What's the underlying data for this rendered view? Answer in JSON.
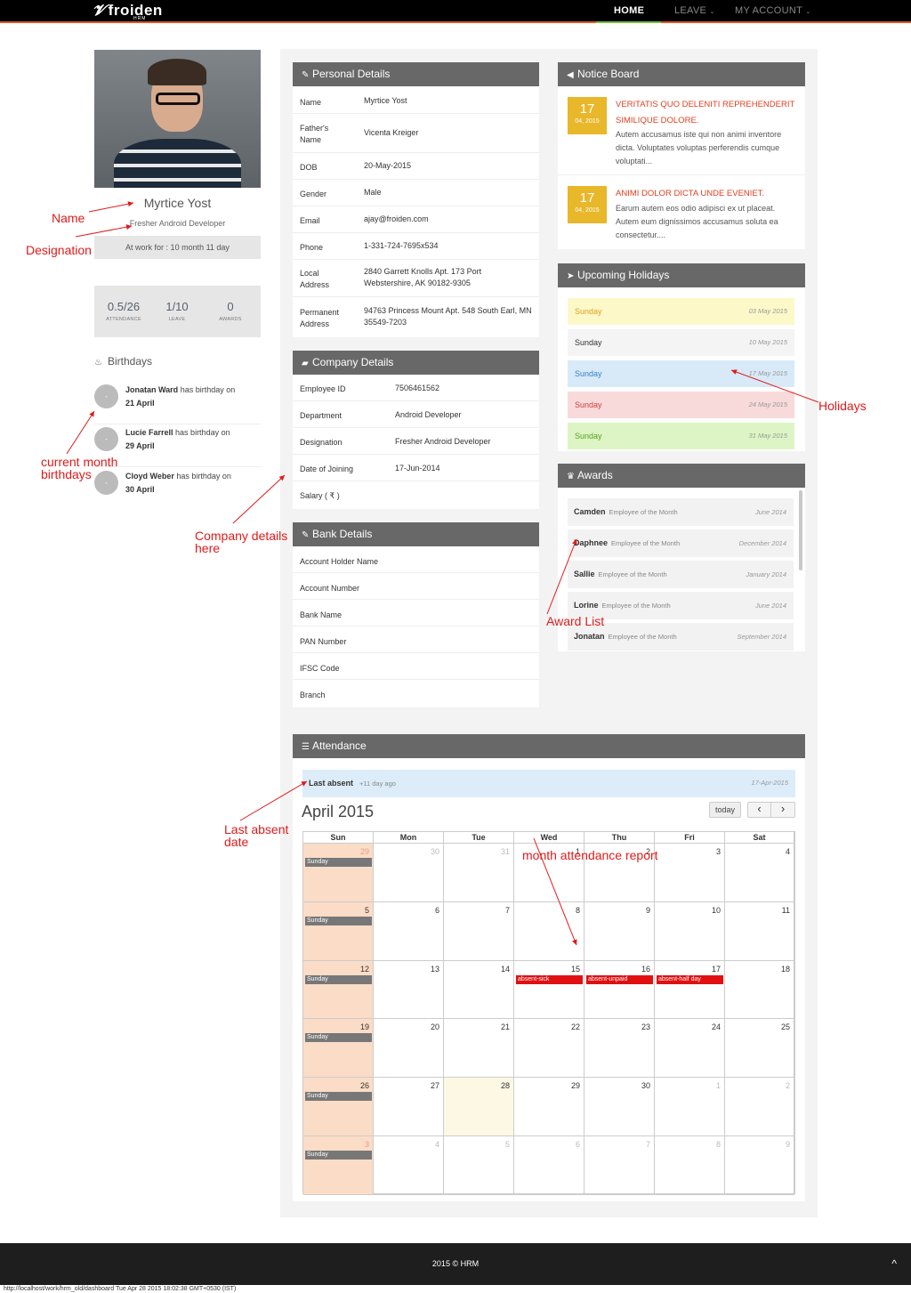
{
  "nav": {
    "logo": "froiden",
    "logo_sub": "HRM",
    "items": [
      "HOME",
      "LEAVE",
      "MY ACCOUNT"
    ]
  },
  "profile": {
    "name": "Myrtice Yost",
    "designation": "Fresher Android Developer",
    "work_for": "At work for : 10 month 11 day",
    "stats": [
      {
        "value": "0.5/26",
        "label": "ATTENDANCE"
      },
      {
        "value": "1/10",
        "label": "LEAVE"
      },
      {
        "value": "0",
        "label": "AWARDS"
      }
    ]
  },
  "birthdays": {
    "title": "Birthdays",
    "text": "has birthday on",
    "items": [
      {
        "name": "Jonatan Ward",
        "date": "21 April"
      },
      {
        "name": "Lucie Farrell",
        "date": "29 April"
      },
      {
        "name": "Cloyd Weber",
        "date": "30 April"
      }
    ]
  },
  "personal": {
    "title": "Personal Details",
    "rows": [
      {
        "k": "Name",
        "v": "Myrtice Yost"
      },
      {
        "k": "Father's Name",
        "v": "Vicenta Kreiger"
      },
      {
        "k": "DOB",
        "v": "20-May-2015"
      },
      {
        "k": "Gender",
        "v": "Male"
      },
      {
        "k": "Email",
        "v": "ajay@froiden.com"
      },
      {
        "k": "Phone",
        "v": "1-331-724-7695x534"
      },
      {
        "k": "Local Address",
        "v": "2840 Garrett Knolls Apt. 173 Port Webstershire, AK 90182-9305"
      },
      {
        "k": "Permanent Address",
        "v": "94763 Princess Mount Apt. 548 South Earl, MN 35549-7203"
      }
    ]
  },
  "company": {
    "title": "Company Details",
    "rows": [
      {
        "k": "Employee ID",
        "v": "7506461562"
      },
      {
        "k": "Department",
        "v": "Android Developer"
      },
      {
        "k": "Designation",
        "v": "Fresher Android Developer"
      },
      {
        "k": "Date of Joining",
        "v": "17-Jun-2014"
      },
      {
        "k": "Salary ( ₹ )",
        "v": ""
      }
    ]
  },
  "bank": {
    "title": "Bank Details",
    "rows": [
      "Account Holder Name",
      "Account Number",
      "Bank Name",
      "PAN Number",
      "IFSC Code",
      "Branch"
    ]
  },
  "notice": {
    "title": "Notice Board",
    "items": [
      {
        "day": "17",
        "month": "04, 2015",
        "title": "VERITATIS QUO DELENITI REPREHENDERIT SIMILIQUE DOLORE.",
        "body": "Autem accusamus iste qui non animi inventore dicta. Voluptates voluptas perferendis cumque voluptati..."
      },
      {
        "day": "17",
        "month": "04, 2015",
        "title": "ANIMI DOLOR DICTA UNDE EVENIET.",
        "body": "Earum autem eos odio adipisci ex ut placeat. Autem eum dignissimos accusamus soluta ea consectetur...."
      }
    ]
  },
  "holidays": {
    "title": "Upcoming Holidays",
    "items": [
      {
        "name": "Sunday",
        "date": "03 May 2015",
        "bg": "#fcf8c8",
        "fg": "#e0a020"
      },
      {
        "name": "Sunday",
        "date": "10 May 2015",
        "bg": "#f4f4f4",
        "fg": "#333333"
      },
      {
        "name": "Sunday",
        "date": "17 May 2015",
        "bg": "#d8eaf8",
        "fg": "#3a80c8"
      },
      {
        "name": "Sunday",
        "date": "24 May 2015",
        "bg": "#f8dada",
        "fg": "#d04040"
      },
      {
        "name": "Sunday",
        "date": "31 May 2015",
        "bg": "#ddf5c4",
        "fg": "#5aa020"
      }
    ]
  },
  "awards": {
    "title": "Awards",
    "items": [
      {
        "name": "Camden",
        "type": "Employee of the Month",
        "date": "June 2014"
      },
      {
        "name": "Daphnee",
        "type": "Employee of the Month",
        "date": "December 2014"
      },
      {
        "name": "Sallie",
        "type": "Employee of the Month",
        "date": "January 2014"
      },
      {
        "name": "Lorine",
        "type": "Employee of the Month",
        "date": "June 2014"
      },
      {
        "name": "Jonatan",
        "type": "Employee of the Month",
        "date": "September 2014"
      }
    ]
  },
  "attendance": {
    "title": "Attendance",
    "last_absent_label": "Last absent",
    "last_absent_ago": "+11 day ago",
    "last_absent_date": "17-Apr-2015",
    "month": "April 2015",
    "today": "today",
    "prev": "‹",
    "next": "›",
    "weekdays": [
      "Sun",
      "Mon",
      "Tue",
      "Wed",
      "Thu",
      "Fri",
      "Sat"
    ],
    "weeks": [
      [
        "29",
        "30",
        "31",
        "1",
        "2",
        "3",
        "4"
      ],
      [
        "5",
        "6",
        "7",
        "8",
        "9",
        "10",
        "11"
      ],
      [
        "12",
        "13",
        "14",
        "15",
        "16",
        "17",
        "18"
      ],
      [
        "19",
        "20",
        "21",
        "22",
        "23",
        "24",
        "25"
      ],
      [
        "26",
        "27",
        "28",
        "29",
        "30",
        "1",
        "2"
      ],
      [
        "3",
        "4",
        "5",
        "6",
        "7",
        "8",
        "9"
      ]
    ],
    "sunday_label": "Sunday",
    "events": [
      {
        "week": 2,
        "day": 3,
        "label": "absent-sick"
      },
      {
        "week": 2,
        "day": 4,
        "label": "absent-unpaid"
      },
      {
        "week": 2,
        "day": 5,
        "label": "absent-half day"
      }
    ]
  },
  "annotations": {
    "name": "Name",
    "designation": "Designation",
    "birthdays": "current month birthdays",
    "company": "Company details here",
    "holidays": "Holidays",
    "awards": "Award List",
    "last_absent": "Last absent date",
    "month_report": "month attendance report"
  },
  "footer": {
    "text": "2015 © HRM",
    "up_icon": "^"
  },
  "status_url": "http://localhost/work/hrm_old/dashboard Tue Apr 28 2015 18:02:38 GMT+0530 (IST)"
}
